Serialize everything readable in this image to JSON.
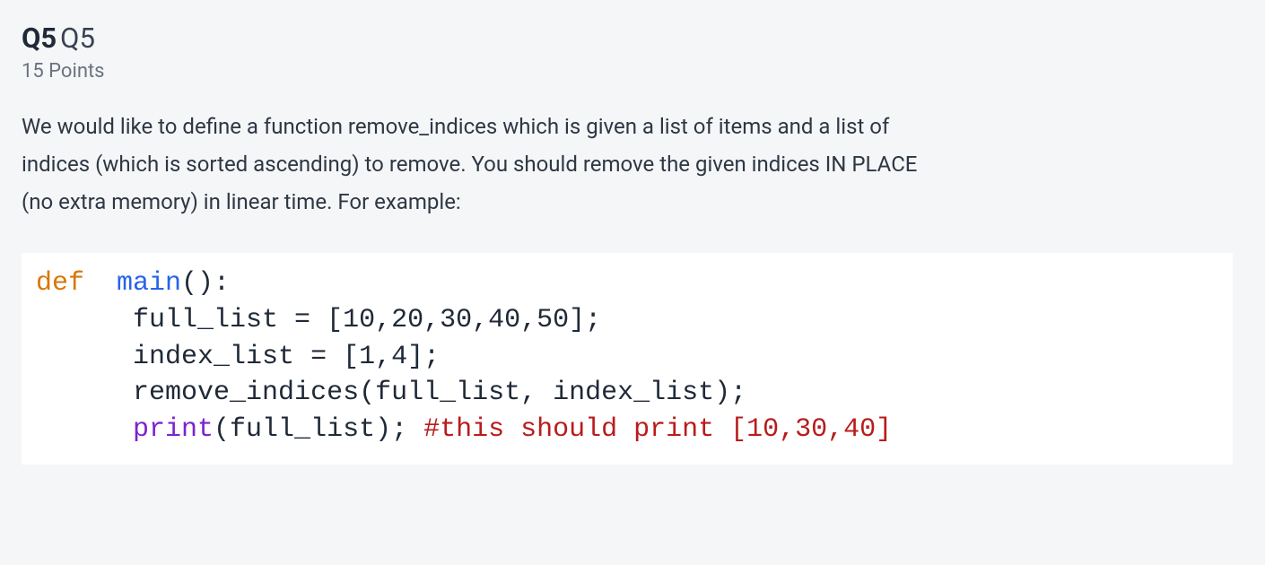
{
  "question": {
    "number": "Q5",
    "title": "Q5",
    "points": "15 Points",
    "description": "We would like to define a function remove_indices which is given a list of items and a list of indices (which is sorted ascending) to remove.  You should remove the given indices IN PLACE (no extra memory) in linear time.  For example:"
  },
  "code": {
    "l1": {
      "def": "def",
      "sp1": "  ",
      "main": "main",
      "rest": "():"
    },
    "l2": {
      "indent": "      ",
      "text": "full_list = [10,20,30,40,50];"
    },
    "l3": {
      "indent": "      ",
      "text": "index_list = [1,4];"
    },
    "l4": {
      "indent": "      ",
      "text": "remove_indices(full_list, index_list);"
    },
    "l5": {
      "indent": "      ",
      "print": "print",
      "args": "(full_list); ",
      "comment": "#this should print [10,30,40]"
    }
  }
}
